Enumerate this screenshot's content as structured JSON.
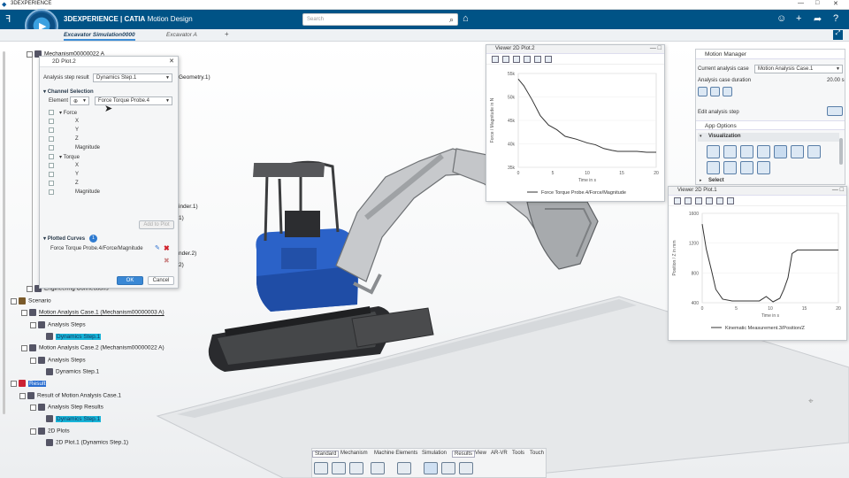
{
  "app": {
    "window_title": "3DEXPERIENCE",
    "brand_bold": "3DEXPERIENCE | CATIA",
    "brand_light": "Motion Design",
    "search_placeholder": "Search",
    "compass_label": "V,R"
  },
  "tabs": [
    {
      "label": "Excavator Simulation0000"
    },
    {
      "label": "Excavator A"
    },
    {
      "label": "+"
    }
  ],
  "tree": {
    "top_item": "Mechanism00000022 A",
    "partial": [
      "Geometry.1)",
      "inder.1)",
      "1)",
      "nder.2)",
      "2)",
      "Engineering Connections"
    ],
    "scenario": "Scenario",
    "case1": "Motion Analysis Case.1 (Mechanism00000003 A)",
    "case2": "Motion Analysis Case.2 (Mechanism00000022 A)",
    "analysis_steps": "Analysis Steps",
    "dynamics_step": "Dynamics Step.1",
    "result": "Result",
    "result_of": "Result of Motion Analysis Case.1",
    "analysis_step_results": "Analysis Step Results",
    "plots_2d": "2D Plots",
    "plot_item": "2D Plot.1 (Dynamics Step.1)"
  },
  "dialog": {
    "title": "2D Plot.2",
    "analysis_step_result_label": "Analysis step result",
    "analysis_step_result_value": "Dynamics Step.1",
    "channel_selection": "Channel Selection",
    "element_label": "Element",
    "element_value": "Force Torque Probe.4",
    "force": "Force",
    "torque": "Torque",
    "x": "X",
    "y": "Y",
    "z": "Z",
    "magnitude": "Magnitude",
    "add_to_plot": "Add to Plot",
    "plotted_curves": "Plotted Curves",
    "plotted_count": "1",
    "curve_name": "Force Torque Probe.4/Force/Magnitude",
    "ok": "OK",
    "cancel": "Cancel"
  },
  "viewer1": {
    "title": "Viewer 2D Plot.2",
    "ylabel": "Force / Magnitude in N",
    "xlabel": "Time in s",
    "legend": "Force Torque Probe.4/Force/Magnitude",
    "yticks": [
      "55k",
      "50k",
      "45k",
      "40k",
      "35k"
    ],
    "xticks": [
      "0",
      "5",
      "10",
      "15",
      "20"
    ]
  },
  "viewer2": {
    "title": "Viewer 2D Plot.1",
    "ylabel": "Position / Z in mm",
    "xlabel": "Time in s",
    "legend": "Kinematic Measurement.3/Position/Z",
    "yticks": [
      "1600",
      "1200",
      "800",
      "400"
    ],
    "xticks": [
      "0",
      "5",
      "10",
      "15",
      "20"
    ]
  },
  "motion_manager": {
    "title": "Motion Manager",
    "current_case_label": "Current analysis case",
    "current_case_value": "Motion Analysis Case.1",
    "duration_label": "Analysis case duration",
    "duration_value": "20.00 s",
    "edit_step": "Edit analysis step",
    "app_options": "App Options",
    "visualization": "Visualization",
    "select": "Select"
  },
  "bottom_tabs": [
    "Standard",
    "Mechanism",
    "Machine Elements",
    "Simulation",
    "Results",
    "View",
    "AR-VR",
    "Tools",
    "Touch"
  ],
  "colors": {
    "brand_blue": "#005386",
    "highlight": "#17b4d8",
    "excavator_blue": "#2b62c8"
  }
}
